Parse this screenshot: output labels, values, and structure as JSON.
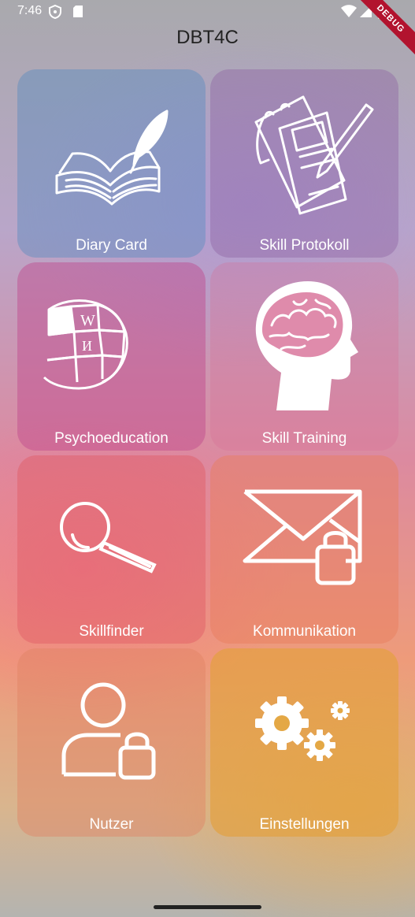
{
  "status_bar": {
    "time": "7:46"
  },
  "debug_banner": "DEBUG",
  "app": {
    "title": "DBT4C"
  },
  "tiles": [
    {
      "label": "Diary Card",
      "icon": "open-book-quill-icon",
      "bg": "rgba(90,140,190,0.45)"
    },
    {
      "label": "Skill Protokoll",
      "icon": "notepad-pencil-icon",
      "bg": "rgba(140,95,160,0.40)"
    },
    {
      "label": "Psychoeducation",
      "icon": "puzzle-globe-icon",
      "bg": "rgba(190,70,140,0.45)"
    },
    {
      "label": "Skill Training",
      "icon": "head-brain-icon",
      "bg": "rgba(215,110,150,0.30)"
    },
    {
      "label": "Skillfinder",
      "icon": "magnifier-icon",
      "bg": "rgba(225,90,100,0.45)"
    },
    {
      "label": "Kommunikation",
      "icon": "envelope-lock-icon",
      "bg": "rgba(232,125,90,0.45)"
    },
    {
      "label": "Nutzer",
      "icon": "user-lock-icon",
      "bg": "rgba(225,130,100,0.45)"
    },
    {
      "label": "Einstellungen",
      "icon": "gears-icon",
      "bg": "rgba(228,160,60,0.65)"
    }
  ]
}
